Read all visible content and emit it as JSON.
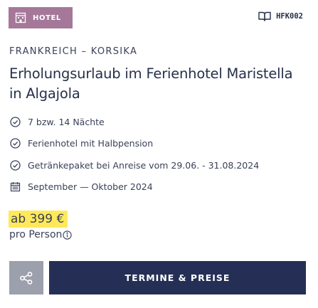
{
  "badge": {
    "label": "HOTEL",
    "icon": "hotel-icon",
    "background": "#a5789a"
  },
  "offer_code": {
    "text": "HFK002",
    "icon": "book-icon"
  },
  "region": "FRANKREICH – KORSIKA",
  "title": "Erholungsurlaub im Ferienhotel Maristella in Algajola",
  "features": [
    {
      "icon": "check-circle-icon",
      "text": "7 bzw. 14 Nächte"
    },
    {
      "icon": "check-circle-icon",
      "text": "Ferienhotel mit Halbpension"
    },
    {
      "icon": "check-circle-icon",
      "text": "Getränkepaket bei Anreise vom 29.06. - 31.08.2024"
    },
    {
      "icon": "calendar-icon",
      "text": "September — Oktober 2024"
    }
  ],
  "price": {
    "text": "ab 399 €",
    "per": "pro Person",
    "highlight": "#ffe95a"
  },
  "actions": {
    "share_icon": "share-icon",
    "cta_label": "TERMINE & PREISE",
    "cta_color": "#252f56"
  }
}
